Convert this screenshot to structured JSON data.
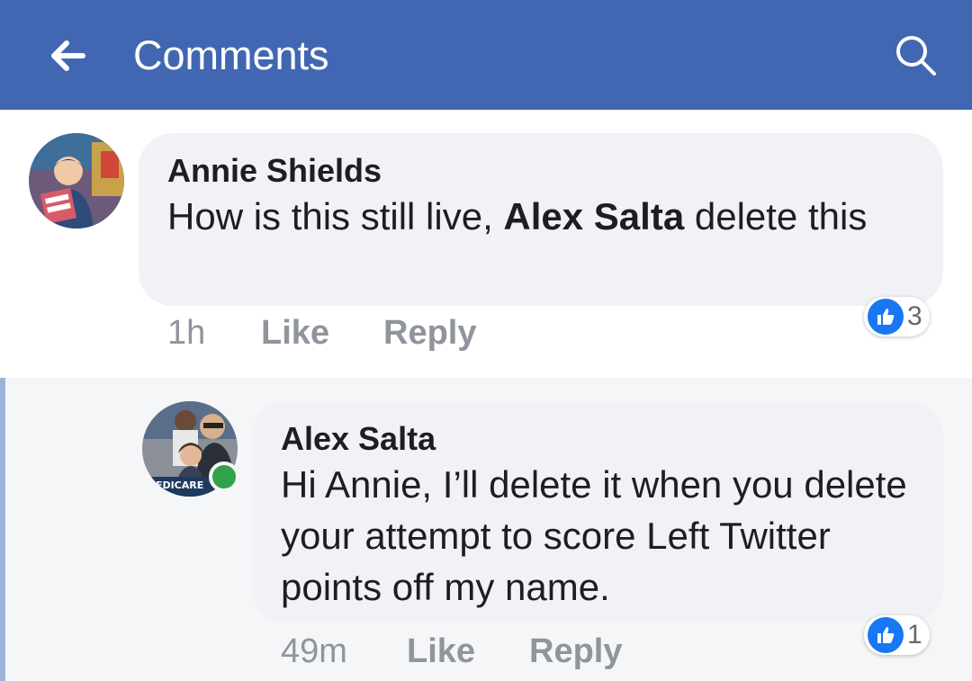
{
  "header": {
    "title": "Comments",
    "back_icon": "arrow-left-icon",
    "search_icon": "search-icon",
    "background": "#4267b2"
  },
  "comments": [
    {
      "author": "Annie Shields",
      "text_before": "How is this still live, ",
      "mention": "Alex Salta",
      "text_after": " delete this",
      "time": "1h",
      "like_label": "Like",
      "reply_label": "Reply",
      "reaction_count": "3",
      "reaction_icon": "thumbs-up-icon"
    },
    {
      "author": "Alex Salta",
      "text": "Hi Annie, I’ll delete it when you delete your attempt to score Left Twitter points off my name.",
      "time": "49m",
      "like_label": "Like",
      "reply_label": "Reply",
      "reaction_count": "1",
      "reaction_icon": "thumbs-up-icon",
      "avatar_badge_text": "MEDICARE",
      "online": true
    }
  ],
  "colors": {
    "bubble": "#f0f2f5",
    "reply_background": "#f5f6f7",
    "thread_line": "#9cb4d8",
    "like_blue": "#1877f2",
    "online_green": "#31a24c",
    "meta_gray": "#90949c"
  }
}
